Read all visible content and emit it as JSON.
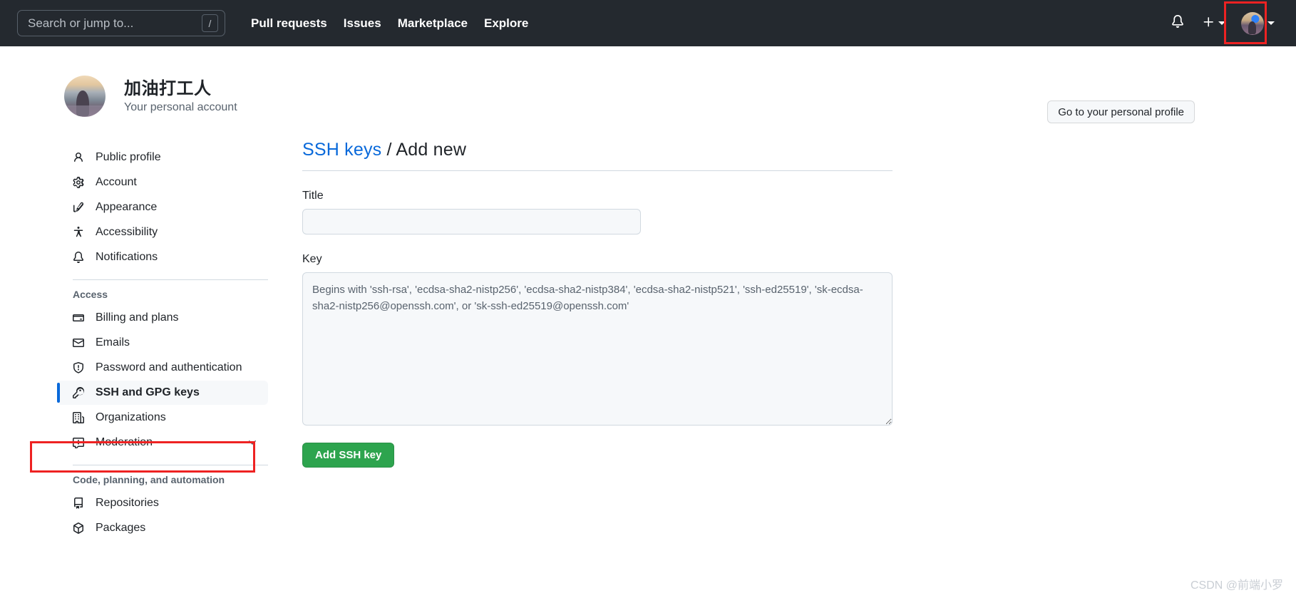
{
  "header": {
    "search": {
      "placeholder": "Search or jump to...",
      "shortcut_key": "/"
    },
    "nav": [
      {
        "label": "Pull requests"
      },
      {
        "label": "Issues"
      },
      {
        "label": "Marketplace"
      },
      {
        "label": "Explore"
      }
    ],
    "icons": {
      "notifications": "bell-icon",
      "create_new": "plus-icon",
      "create_new_caret": "chevron-down-icon",
      "avatar": "user-avatar",
      "avatar_caret": "chevron-down-icon"
    },
    "background_color": "#24292f"
  },
  "account": {
    "name": "加油打工人",
    "subtitle": "Your personal account",
    "profile_button_label": "Go to your personal profile"
  },
  "sidebar": {
    "groups": [
      {
        "title": "",
        "items": [
          {
            "label": "Public profile",
            "icon": "person-icon",
            "selected": false
          },
          {
            "label": "Account",
            "icon": "gear-icon",
            "selected": false
          },
          {
            "label": "Appearance",
            "icon": "paintbrush-icon",
            "selected": false
          },
          {
            "label": "Accessibility",
            "icon": "accessibility-icon",
            "selected": false
          },
          {
            "label": "Notifications",
            "icon": "bell-icon",
            "selected": false
          }
        ]
      },
      {
        "title": "Access",
        "items": [
          {
            "label": "Billing and plans",
            "icon": "credit-card-icon",
            "selected": false
          },
          {
            "label": "Emails",
            "icon": "mail-icon",
            "selected": false
          },
          {
            "label": "Password and authentication",
            "icon": "shield-icon",
            "selected": false
          },
          {
            "label": "SSH and GPG keys",
            "icon": "key-icon",
            "selected": true
          },
          {
            "label": "Organizations",
            "icon": "organization-icon",
            "selected": false
          },
          {
            "label": "Moderation",
            "icon": "report-icon",
            "selected": false,
            "expandable": true
          }
        ]
      },
      {
        "title": "Code, planning, and automation",
        "items": [
          {
            "label": "Repositories",
            "icon": "repo-icon",
            "selected": false
          },
          {
            "label": "Packages",
            "icon": "package-icon",
            "selected": false
          }
        ]
      }
    ],
    "selected_accent_color": "#0969da"
  },
  "main": {
    "breadcrumb_link": "SSH keys",
    "breadcrumb_separator": " / ",
    "breadcrumb_current": "Add new",
    "title_label": "Title",
    "title_value": "",
    "title_placeholder": "",
    "key_label": "Key",
    "key_value": "",
    "key_placeholder": "Begins with 'ssh-rsa', 'ecdsa-sha2-nistp256', 'ecdsa-sha2-nistp384', 'ecdsa-sha2-nistp521', 'ssh-ed25519', 'sk-ecdsa-sha2-nistp256@openssh.com', or 'sk-ssh-ed25519@openssh.com'",
    "submit_label": "Add SSH key",
    "submit_color": "#2da44e"
  },
  "annotations": {
    "highlight_color": "#ee2222",
    "avatar_box": true,
    "ssh_nav_box": true
  },
  "watermark": "CSDN @前端小罗"
}
